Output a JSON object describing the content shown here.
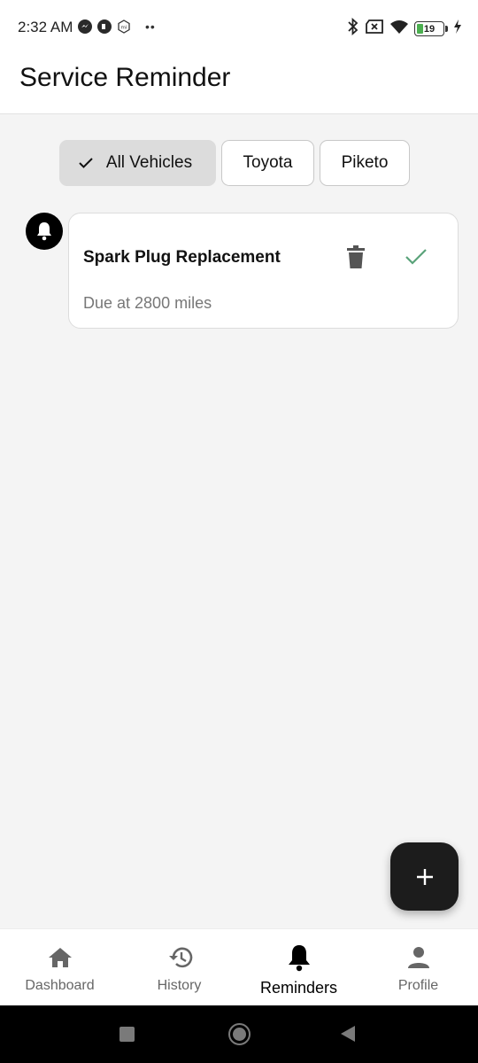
{
  "status_bar": {
    "time": "2:32 AM",
    "battery_level": "19",
    "left_icons": [
      "messenger-icon",
      "app-icon",
      "mi-icon",
      "more-dots-icon"
    ],
    "right_icons": [
      "bluetooth-icon",
      "sim-x-icon",
      "wifi-icon",
      "battery-icon",
      "charging-icon"
    ]
  },
  "app_bar": {
    "title": "Service Reminder"
  },
  "filters": {
    "chips": [
      {
        "label": "All Vehicles",
        "selected": true
      },
      {
        "label": "Toyota",
        "selected": false
      },
      {
        "label": "Piketo",
        "selected": false
      }
    ]
  },
  "reminders": [
    {
      "title": "Spark Plug Replacement",
      "subtitle": "Due at 2800 miles",
      "icon": "bell-icon"
    }
  ],
  "fab": {
    "icon": "plus-icon"
  },
  "bottom_nav": {
    "items": [
      {
        "label": "Dashboard",
        "icon": "home-icon",
        "active": false
      },
      {
        "label": "History",
        "icon": "history-icon",
        "active": false
      },
      {
        "label": "Reminders",
        "icon": "bell-icon",
        "active": true
      },
      {
        "label": "Profile",
        "icon": "person-icon",
        "active": false
      }
    ]
  },
  "colors": {
    "background": "#f4f4f4",
    "surface": "#ffffff",
    "selected_chip": "#dcdcdc",
    "check_green": "#5aa37a",
    "fab": "#1c1c1c"
  }
}
